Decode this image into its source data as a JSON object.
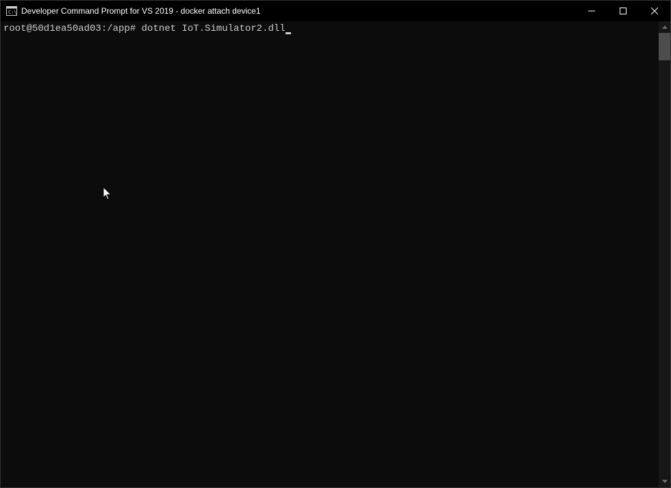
{
  "window": {
    "title": "Developer Command Prompt for VS 2019 - docker  attach device1"
  },
  "terminal": {
    "prompt": "root@50d1ea50ad03:/app#",
    "command": " dotnet IoT.Simulator2.dll"
  }
}
